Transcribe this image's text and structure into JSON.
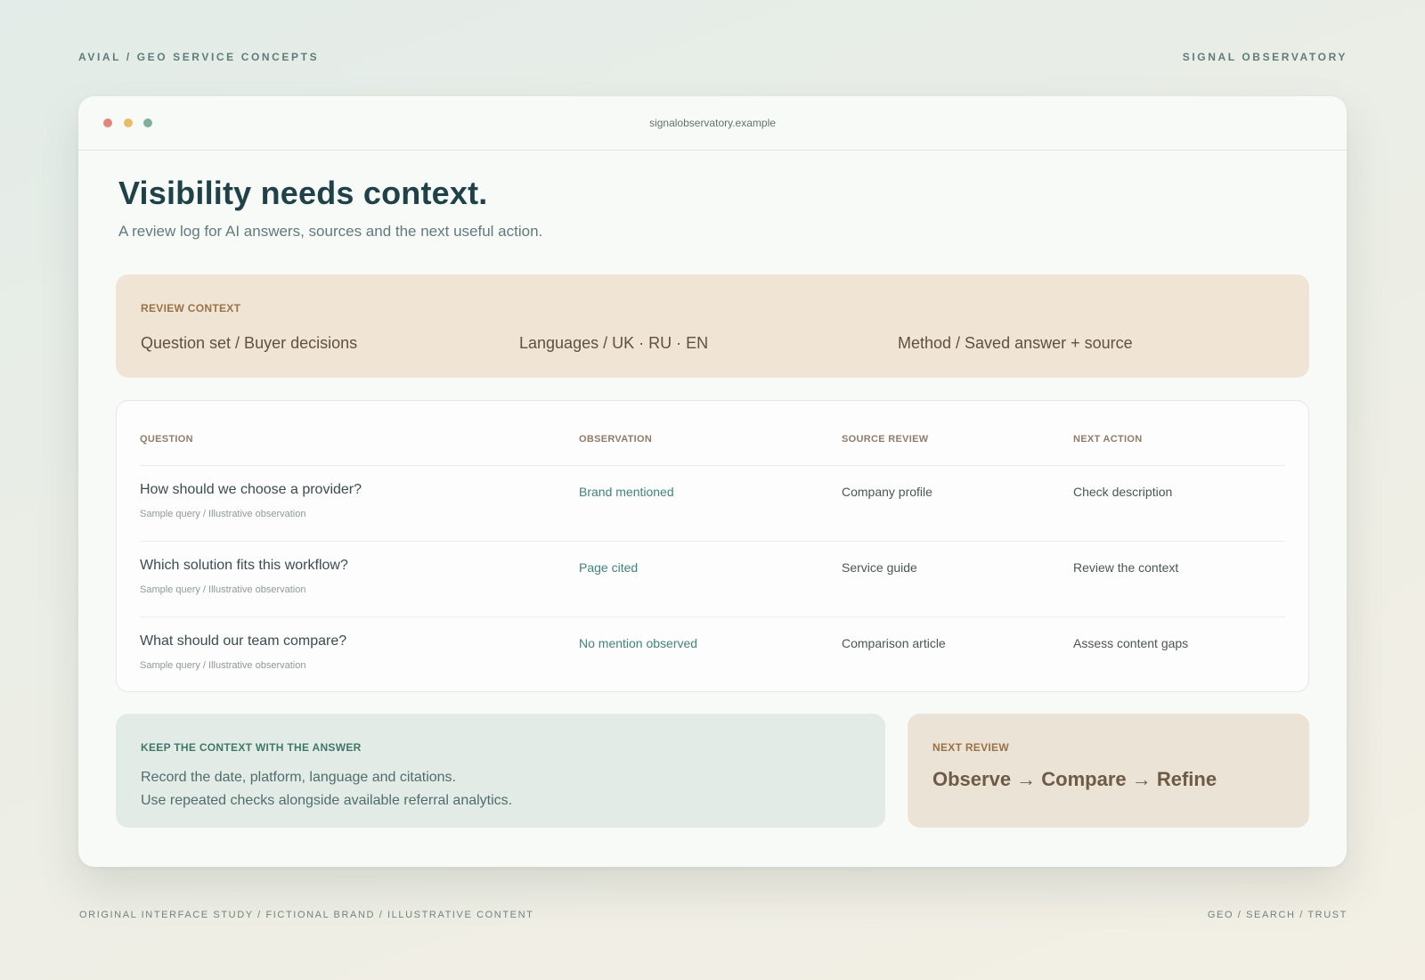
{
  "page": {
    "top_left": "AVIAL / GEO SERVICE CONCEPTS",
    "top_right": "SIGNAL OBSERVATORY",
    "bottom_left": "ORIGINAL INTERFACE STUDY / FICTIONAL BRAND / ILLUSTRATIVE CONTENT",
    "bottom_right": "GEO / SEARCH / TRUST"
  },
  "browser": {
    "url": "signalobservatory.example",
    "controls": [
      "close-dot",
      "minimize-dot",
      "maximize-dot"
    ]
  },
  "hero": {
    "title": "Visibility needs context.",
    "subtitle": "A review log for AI answers, sources and the next useful action."
  },
  "review_context": {
    "label": "REVIEW CONTEXT",
    "items": [
      "Question set / Buyer decisions",
      "Languages / UK · RU · EN",
      "Method / Saved answer + source"
    ]
  },
  "table": {
    "headers": [
      "QUESTION",
      "OBSERVATION",
      "SOURCE REVIEW",
      "NEXT ACTION"
    ],
    "rows": [
      {
        "question": "How should we choose a provider?",
        "note": "Sample query / Illustrative observation",
        "observation": "Brand mentioned",
        "source": "Company profile",
        "action": "Check description"
      },
      {
        "question": "Which solution fits this workflow?",
        "note": "Sample query / Illustrative observation",
        "observation": "Page cited",
        "source": "Service guide",
        "action": "Review the context"
      },
      {
        "question": "What should our team compare?",
        "note": "Sample query / Illustrative observation",
        "observation": "No mention observed",
        "source": "Comparison article",
        "action": "Assess content gaps"
      }
    ]
  },
  "keep_context": {
    "label": "KEEP THE CONTEXT WITH THE ANSWER",
    "lines": [
      "Record the date, platform, language and citations.",
      "Use repeated checks alongside available referral analytics."
    ]
  },
  "next_review": {
    "label": "NEXT REVIEW",
    "flow": "Observe → Compare → Refine"
  },
  "colors": {
    "accent_teal": "#3f8577",
    "headline": "#1f4249",
    "context_bg": "#f0e5d4",
    "keep_bg": "#e3ebe7",
    "next_bg": "#ebe3d5"
  }
}
